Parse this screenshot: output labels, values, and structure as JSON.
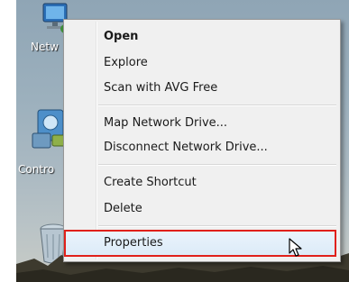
{
  "desktop": {
    "icons": [
      {
        "label": "Netw",
        "icon": "network-icon"
      },
      {
        "label": "Contro",
        "icon": "control-panel-icon"
      },
      {
        "label": "",
        "icon": "recycle-bin-icon"
      }
    ]
  },
  "context_menu": {
    "items": [
      {
        "label": "Open",
        "bold": true
      },
      {
        "label": "Explore"
      },
      {
        "label": "Scan with AVG Free"
      },
      {
        "label": "Map Network Drive..."
      },
      {
        "label": "Disconnect Network Drive..."
      },
      {
        "label": "Create Shortcut"
      },
      {
        "label": "Delete"
      },
      {
        "label": "Properties",
        "highlighted": true
      }
    ]
  },
  "colors": {
    "highlight_border": "#e0201a",
    "menu_background": "#f0f0f0"
  }
}
